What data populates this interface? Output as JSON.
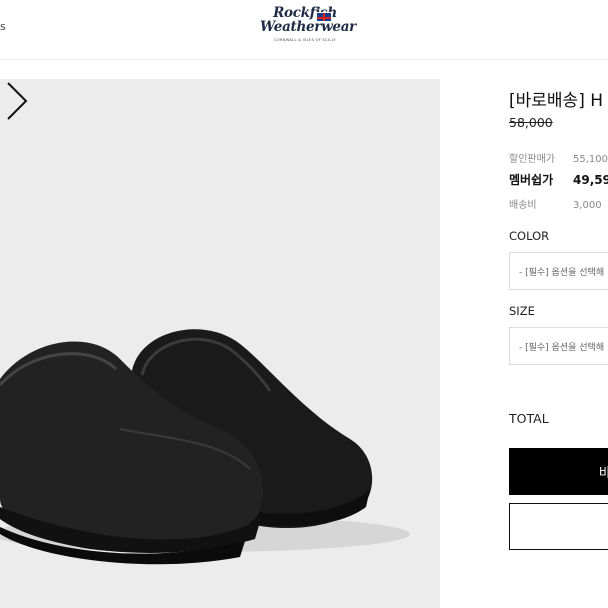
{
  "header": {
    "left_glyph": "s",
    "logo": {
      "line1": "Rockfish",
      "line2": "Weatherwear",
      "tagline": "CORNWALL & ISLES OF SCILLY"
    }
  },
  "product": {
    "title": "[바로배송] H",
    "original_price": "58,000",
    "prices": [
      {
        "label": "할인판매가",
        "value": "55,100"
      },
      {
        "label": "멤버쉽가",
        "value": "49,59"
      },
      {
        "label": "배송비",
        "value": "3,000"
      }
    ],
    "options": [
      {
        "label": "COLOR",
        "placeholder": "- [필수] 옵션을 선택해"
      },
      {
        "label": "SIZE",
        "placeholder": "- [필수] 옵션을 선택해"
      }
    ],
    "total_label": "TOTAL",
    "buy_label": "바",
    "cart_label": ""
  },
  "image": {
    "background_color": "#ececec",
    "next_icon": "chevron-right-icon"
  }
}
